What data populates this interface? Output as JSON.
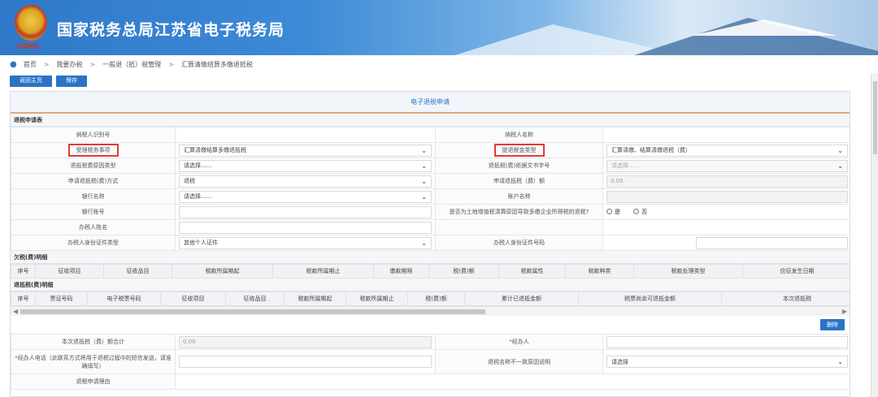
{
  "header": {
    "title": "国家税务总局江苏省电子税务局",
    "motto": "中国税务"
  },
  "breadcrumb": [
    "首页",
    "我要办税",
    "一般退（抵）税管理",
    "汇算清缴结算多缴退抵税"
  ],
  "toolbar": {
    "back_label": "返回主页",
    "save_label": "保存"
  },
  "panel_title": "电子退税申请",
  "section1": "退税申请表",
  "form": {
    "taxpayer_id_label": "纳税人识别号",
    "taxpayer_name_label": "纳税人名称",
    "tax_matter_label": "受理税务事项",
    "tax_matter_value": "汇算清缴结算多缴退抵税",
    "refund_type_label": "提退税金类型",
    "refund_type_value": "汇算清缴、结算清缴退税（费）",
    "reason_type_label": "退抵税费原因类型",
    "reason_type_value": "请选择......",
    "doc_no_label": "退抵税(费)依据文书字号",
    "doc_no_value": "请选择......",
    "method_label": "申请退抵税(费)方式",
    "method_value": "退税",
    "amount_label": "申请退抵税（费）额",
    "amount_value": "0.00",
    "bank_label": "银行名称",
    "bank_value": "请选择......",
    "account_name_label": "账户名称",
    "bank_account_label": "银行账号",
    "land_vat_label": "是否为土地增值税清算原因导致多缴企业所得税的退税?",
    "yes_label": "是",
    "no_label": "否",
    "handler_name_label": "办税人姓名",
    "id_type_label": "办税人身份证件类型",
    "id_type_value": "其他个人证件",
    "id_no_label": "办税人身份证件号码"
  },
  "section2": "欠税(费)明细",
  "arrears_columns": [
    "序号",
    "征收项目",
    "征收品目",
    "税款所属期起",
    "税款所属期止",
    "缴款期限",
    "税(费)额",
    "税款属性",
    "税款种类",
    "税款处理类型",
    "应征发生日期"
  ],
  "section3": "退抵税(费)明细",
  "refund_columns": [
    "序号",
    "票证号码",
    "电子税票号码",
    "征收项目",
    "征收品目",
    "税款所属期起",
    "税款所属期止",
    "税(费)额",
    "累计已退抵金额",
    "税票尚余可退抵金额",
    "本次退抵税"
  ],
  "delete_label": "删除",
  "bottom": {
    "total_label": "本次退抵税（费）额合计",
    "total_value": "0.00",
    "handler_label": "经办人",
    "phone_label": "经办人电话（此联系方式将用于退税过程中的短信发送，请准确填写）",
    "mismatch_label": "退税名称不一致原因说明",
    "mismatch_value": "请选择",
    "reason_label": "退税申请理由"
  }
}
